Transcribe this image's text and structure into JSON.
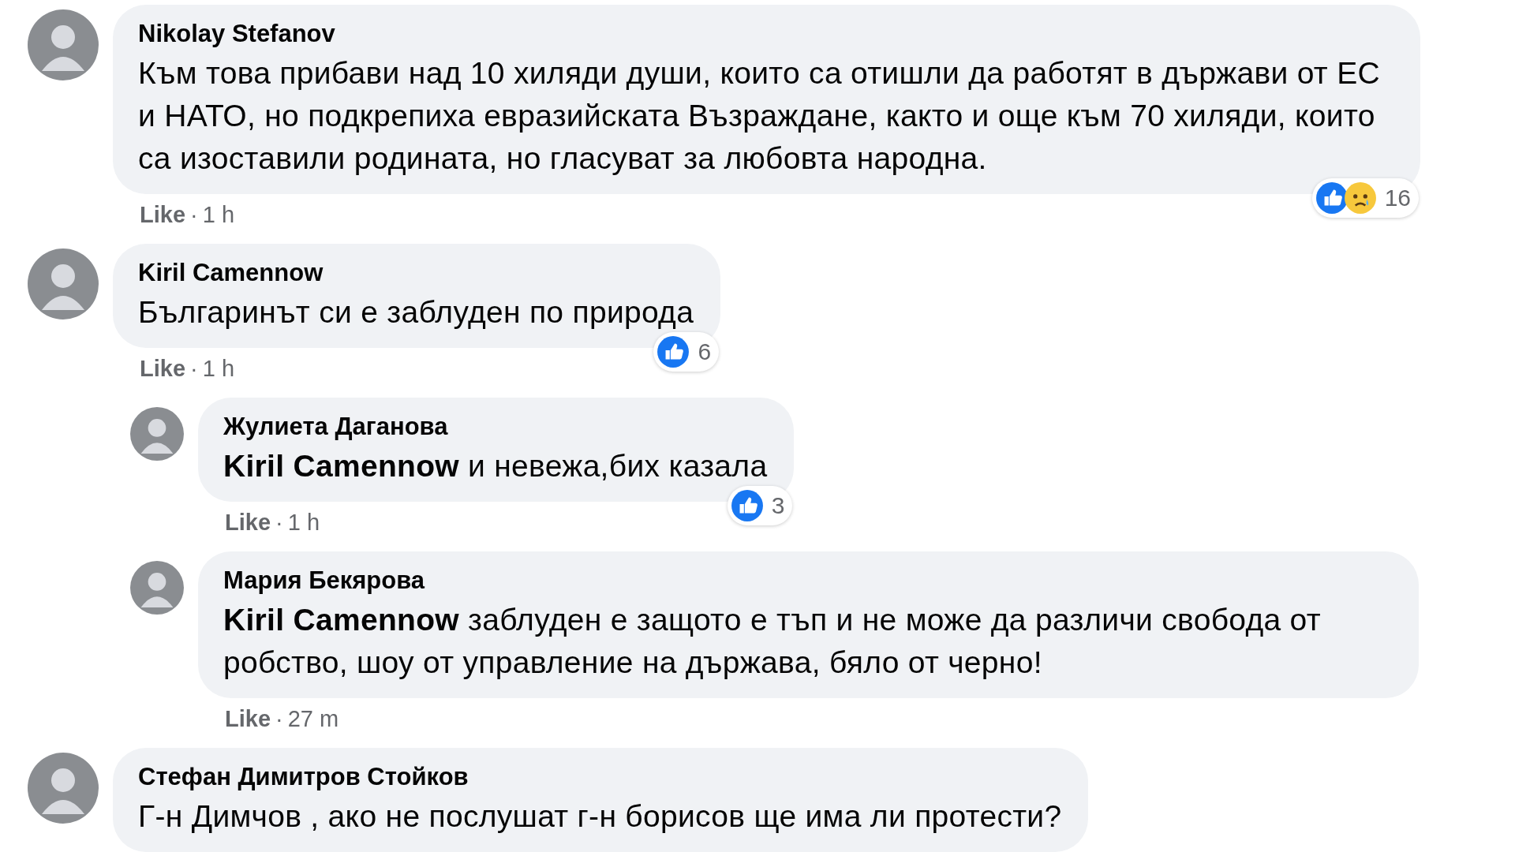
{
  "comments": [
    {
      "name": "Nikolay Stefanov",
      "text": "Към това прибави над 10 хиляди души, които са отишли да работят в държави от ЕС и НАТО, но подкрепиха евразийската Възраждане, както и още към 70 хиляди, които са изоставили родината, но гласуват за любовта народна.",
      "like_label": "Like",
      "separator": "·",
      "time": "1 h",
      "reactions": {
        "icons": [
          {
            "kind": "like"
          },
          {
            "kind": "sad"
          }
        ],
        "count": "16"
      }
    },
    {
      "name": "Kiril Camennow",
      "text": "Българинът си е заблуден по природа",
      "like_label": "Like",
      "separator": "·",
      "time": "1 h",
      "reactions": {
        "icons": [
          {
            "kind": "like"
          }
        ],
        "count": "6"
      },
      "replies": [
        {
          "name": "Жулиета Даганова",
          "mention": "Kiril Camennow",
          "text": "и невежа,бих казала",
          "like_label": "Like",
          "separator": "·",
          "time": "1 h",
          "reactions": {
            "icons": [
              {
                "kind": "like"
              }
            ],
            "count": "3"
          }
        },
        {
          "name": "Мария Бекярова",
          "mention": "Kiril Camennow",
          "text": "заблуден е защото е тъп и не може да различи свобода от робство, шоу от управление на държава, бяло от черно!",
          "like_label": "Like",
          "separator": "·",
          "time": "27 m"
        }
      ]
    },
    {
      "name": "Стефан Димитров Стойков",
      "text": "Г-н Димчов , ако не послушат г-н борисов ще има ли протести?"
    }
  ]
}
